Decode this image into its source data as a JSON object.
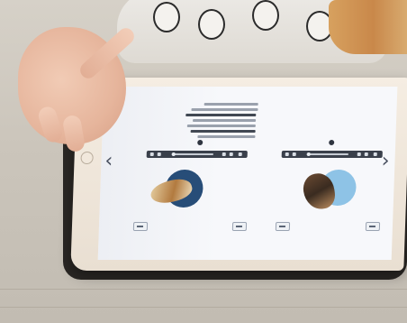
{
  "photo": {
    "subject": "child-using-tablet",
    "colors": {
      "table": "#cbc5bb",
      "ipad_body": "#f1e8dc",
      "screen": "#f7f8fb",
      "model_left": "#2c5a8a",
      "model_right": "#8ec3e6"
    }
  },
  "screen": {
    "left_arrow": "‹",
    "right_arrow": "›",
    "viewers": [
      {
        "name": "left-viewer"
      },
      {
        "name": "right-viewer"
      }
    ]
  },
  "icons": {
    "prev": "chevron-left-icon",
    "next": "chevron-right-icon",
    "home": "home-button-icon"
  }
}
